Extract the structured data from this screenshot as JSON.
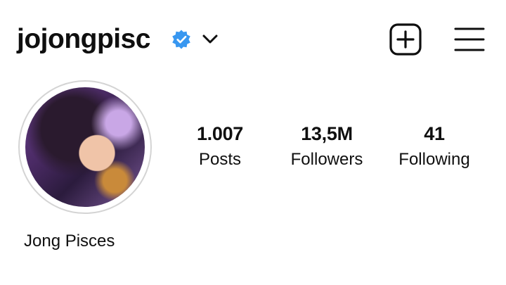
{
  "profile": {
    "username": "jojongpisc",
    "display_name": "Jong Pisces",
    "verified": true
  },
  "icons": {
    "verified": "verified-badge-icon",
    "chevron": "chevron-down-icon",
    "new_post": "plus-square-icon",
    "menu": "hamburger-menu-icon"
  },
  "stats": {
    "posts": {
      "value": "1.007",
      "label": "Posts"
    },
    "followers": {
      "value": "13,5M",
      "label": "Followers"
    },
    "following": {
      "value": "41",
      "label": "Following"
    }
  },
  "colors": {
    "verified_blue": "#3897f0",
    "text": "#0f0f0f",
    "avatar_ring": "#d4d4d4"
  }
}
